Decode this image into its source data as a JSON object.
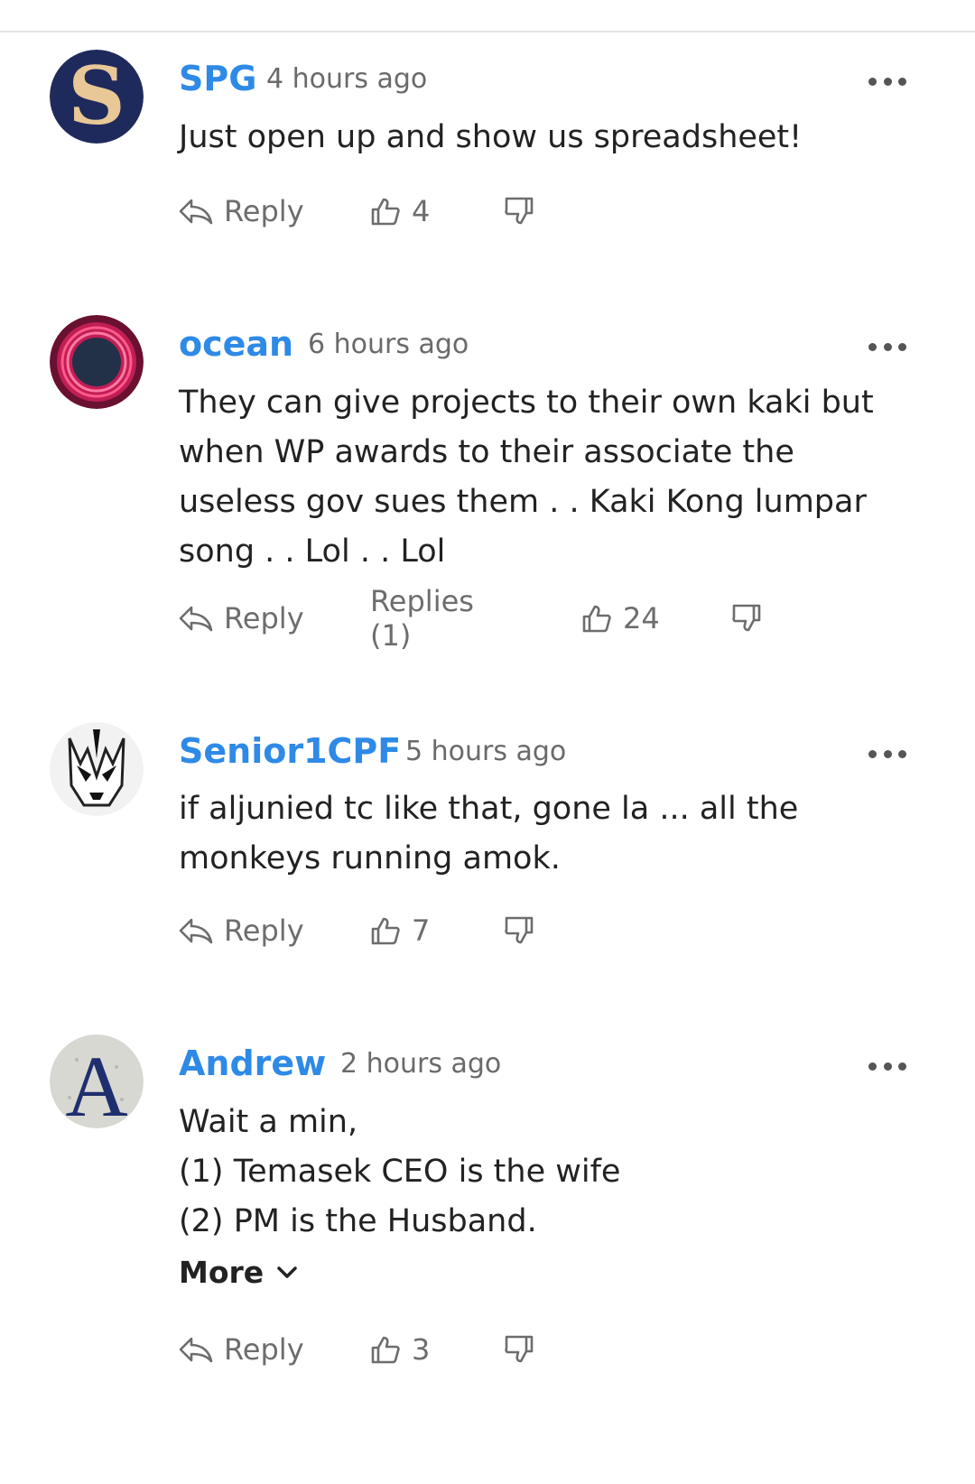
{
  "accent_color": "#2e8ae6",
  "comments": [
    {
      "author": "SPG",
      "time": "4 hours ago",
      "avatar_icon": "letter-s-avatar",
      "lines": [
        "Just open up and show us spreadsheet!"
      ],
      "reply_label": "Reply",
      "likes": "4"
    },
    {
      "author": "ocean",
      "time": "6 hours ago",
      "avatar_icon": "ring-avatar",
      "lines": [
        "They can give projects to their own kaki but",
        "when WP awards to their associate the",
        "useless gov sues them . . Kaki Kong lumpar",
        "song . . Lol . . Lol"
      ],
      "reply_label": "Reply",
      "replies_label": "Replies (1)",
      "likes": "24"
    },
    {
      "author": "Senior1CPF",
      "time": "5 hours ago",
      "avatar_icon": "mask-avatar",
      "lines": [
        "if aljunied tc like that, gone la ... all the",
        "monkeys running amok."
      ],
      "reply_label": "Reply",
      "likes": "7"
    },
    {
      "author": "Andrew",
      "time": "2 hours ago",
      "avatar_icon": "letter-a-avatar",
      "lines": [
        "Wait a min,",
        "(1) Temasek CEO is the wife",
        "(2) PM is the Husband."
      ],
      "more_label": "More",
      "reply_label": "Reply",
      "likes": "3"
    }
  ]
}
